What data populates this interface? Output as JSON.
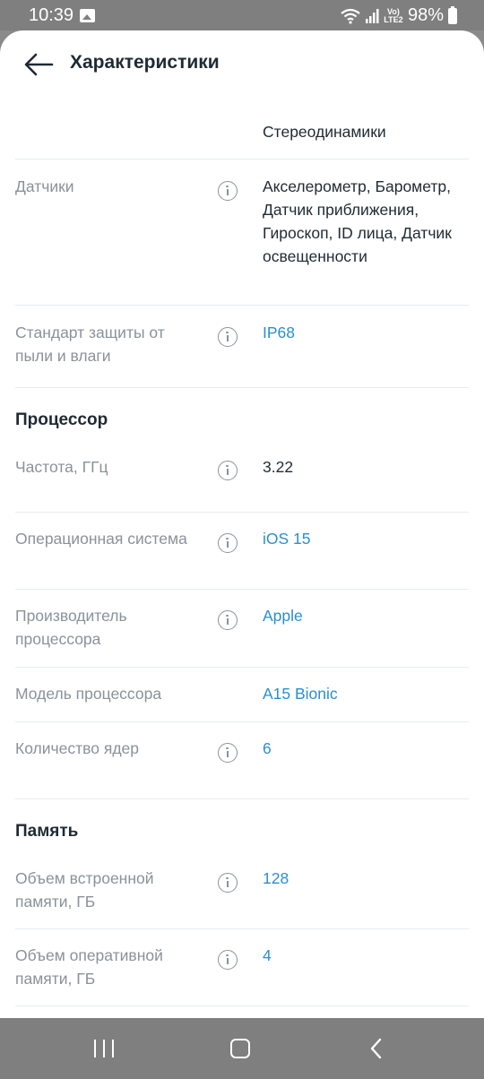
{
  "status_bar": {
    "time": "10:39",
    "lte_label": "Vo) LTE2",
    "battery": "98%"
  },
  "header": {
    "title": "Характеристики"
  },
  "rows_top": [
    {
      "label": "",
      "value": "Стереодинамики",
      "info": false,
      "link": false
    },
    {
      "label": "Датчики",
      "value": "Акселерометр, Барометр, Датчик приближения, Гироскоп, ID лица, Датчик освещенности",
      "info": true,
      "link": false
    },
    {
      "label": "Стандарт защиты от пыли и влаги",
      "value": "IP68",
      "info": true,
      "link": true
    }
  ],
  "sections": [
    {
      "title": "Процессор",
      "rows": [
        {
          "label": "Частота, ГГц",
          "value": "3.22",
          "info": true,
          "link": false
        },
        {
          "label": "Операционная система",
          "value": "iOS 15",
          "info": true,
          "link": true
        },
        {
          "label": "Производитель процессора",
          "value": "Apple",
          "info": true,
          "link": true
        },
        {
          "label": "Модель процессора",
          "value": "A15 Bionic",
          "info": false,
          "link": true
        },
        {
          "label": "Количество ядер",
          "value": "6",
          "info": true,
          "link": true
        }
      ]
    },
    {
      "title": "Память",
      "rows": [
        {
          "label": "Объем встроенной памяти, ГБ",
          "value": "128",
          "info": true,
          "link": true
        },
        {
          "label": "Объем оперативной памяти, ГБ",
          "value": "4",
          "info": true,
          "link": true
        }
      ]
    }
  ],
  "colors": {
    "link": "#2a8fd0",
    "label": "#8a9299",
    "text": "#1f2a33",
    "divider": "#e8ecef"
  }
}
